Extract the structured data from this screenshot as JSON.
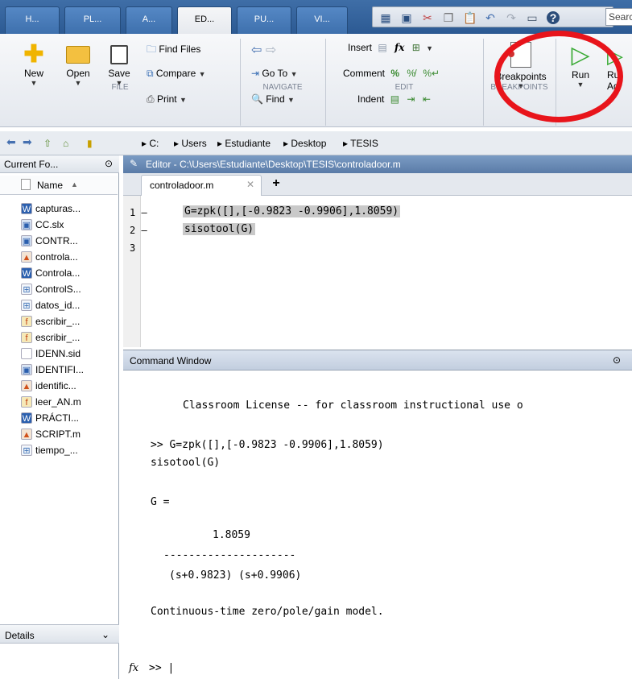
{
  "tabs": [
    {
      "label": "H..."
    },
    {
      "label": "PL..."
    },
    {
      "label": "A..."
    },
    {
      "label": "ED..."
    },
    {
      "label": "PU..."
    },
    {
      "label": "VI..."
    }
  ],
  "search": {
    "value": "Searc"
  },
  "ribbon": {
    "file": {
      "new": "New",
      "open": "Open",
      "save": "Save",
      "find_files": "Find Files",
      "compare": "Compare",
      "print": "Print",
      "label": "FILE"
    },
    "navigate": {
      "go_to": "Go To",
      "find": "Find",
      "label": "NAVIGATE"
    },
    "edit": {
      "insert": "Insert",
      "comment": "Comment",
      "indent": "Indent",
      "label": "EDIT"
    },
    "breakpoints": {
      "button": "Breakpoints",
      "label": "BREAKPOINTS"
    },
    "run": {
      "run": "Run",
      "run_advance_1": "Ru",
      "run_advance_2": "Ad"
    }
  },
  "address": {
    "crumbs": [
      "C:",
      "Users",
      "Estudiante",
      "Desktop",
      "TESIS"
    ]
  },
  "current_folder": {
    "title": "Current Fo...",
    "header": "Name",
    "files": [
      {
        "name": "capturas...",
        "type": "word"
      },
      {
        "name": "CC.slx",
        "type": "simulink"
      },
      {
        "name": "CONTR...",
        "type": "simulink"
      },
      {
        "name": "controla...",
        "type": "matlab"
      },
      {
        "name": "Controla...",
        "type": "word"
      },
      {
        "name": "ControlS...",
        "type": "table"
      },
      {
        "name": "datos_id...",
        "type": "table"
      },
      {
        "name": "escribir_...",
        "type": "function"
      },
      {
        "name": "escribir_...",
        "type": "function"
      },
      {
        "name": "IDENN.sid",
        "type": "blank"
      },
      {
        "name": "IDENTIFI...",
        "type": "simulink"
      },
      {
        "name": "identific...",
        "type": "matlab"
      },
      {
        "name": "leer_AN.m",
        "type": "function"
      },
      {
        "name": "PRÁCTI...",
        "type": "word"
      },
      {
        "name": "SCRIPT.m",
        "type": "matlab"
      },
      {
        "name": "tiempo_...",
        "type": "table"
      }
    ],
    "details": "Details"
  },
  "editor": {
    "title": "Editor - C:\\Users\\Estudiante\\Desktop\\TESIS\\controladoor.m",
    "tab": "controladoor.m",
    "lines": [
      {
        "num": "1",
        "marker": "–",
        "code": "G=zpk([],[-0.9823 -0.9906],1.8059)"
      },
      {
        "num": "2",
        "marker": "–",
        "code": "sisotool(G)"
      },
      {
        "num": "3",
        "marker": "",
        "code": ""
      }
    ]
  },
  "command_window": {
    "title": "Command Window",
    "license": "Classroom License -- for classroom instructional use o",
    "cmd1": ">> G=zpk([],[-0.9823 -0.9906],1.8059)",
    "cmd2": "sisotool(G)",
    "g_eq": "G =",
    "numerator": "1.8059",
    "fraction_bar": "---------------------",
    "denominator": "(s+0.9823) (s+0.9906)",
    "model": "Continuous-time zero/pole/gain model.",
    "prompt": ">>"
  },
  "colors": {
    "highlight": "#e8141b",
    "accent": "#3f6ea7"
  }
}
